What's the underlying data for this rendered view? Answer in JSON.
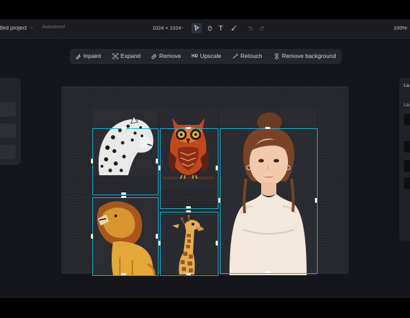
{
  "topbar": {
    "project_title": "itled project",
    "save_status": "Autosaved",
    "canvas_size": "1024 × 1024",
    "zoom": "100%",
    "tools": [
      {
        "name": "select-icon",
        "active": true
      },
      {
        "name": "hand-icon",
        "active": false
      },
      {
        "name": "text-tool-icon",
        "active": false
      },
      {
        "name": "brush-icon",
        "active": false
      },
      {
        "name": "undo-icon",
        "active": false
      },
      {
        "name": "redo-icon",
        "active": false
      }
    ]
  },
  "ai_toolbar": {
    "inpaint": "Inpaint",
    "expand": "Expand",
    "remove": "Remove",
    "upscale_badge": "HD",
    "upscale": "Upscale",
    "retouch": "Retouch",
    "remove_background": "Remove background"
  },
  "right_panel": {
    "heading": "La",
    "subheading": "La"
  },
  "canvas": {
    "images": [
      {
        "name": "leopard-image",
        "subject": "leopard"
      },
      {
        "name": "owl-image",
        "subject": "owl"
      },
      {
        "name": "lion-image",
        "subject": "lion"
      },
      {
        "name": "giraffe-image",
        "subject": "giraffe"
      },
      {
        "name": "portrait-image",
        "subject": "girl portrait"
      }
    ],
    "selection_color": "#1ab3cf"
  },
  "colors": {
    "app_bg": "#14161b",
    "topbar_bg": "#1b1d22",
    "toolbar_bg": "#23262c",
    "accent": "#1ab3cf"
  }
}
